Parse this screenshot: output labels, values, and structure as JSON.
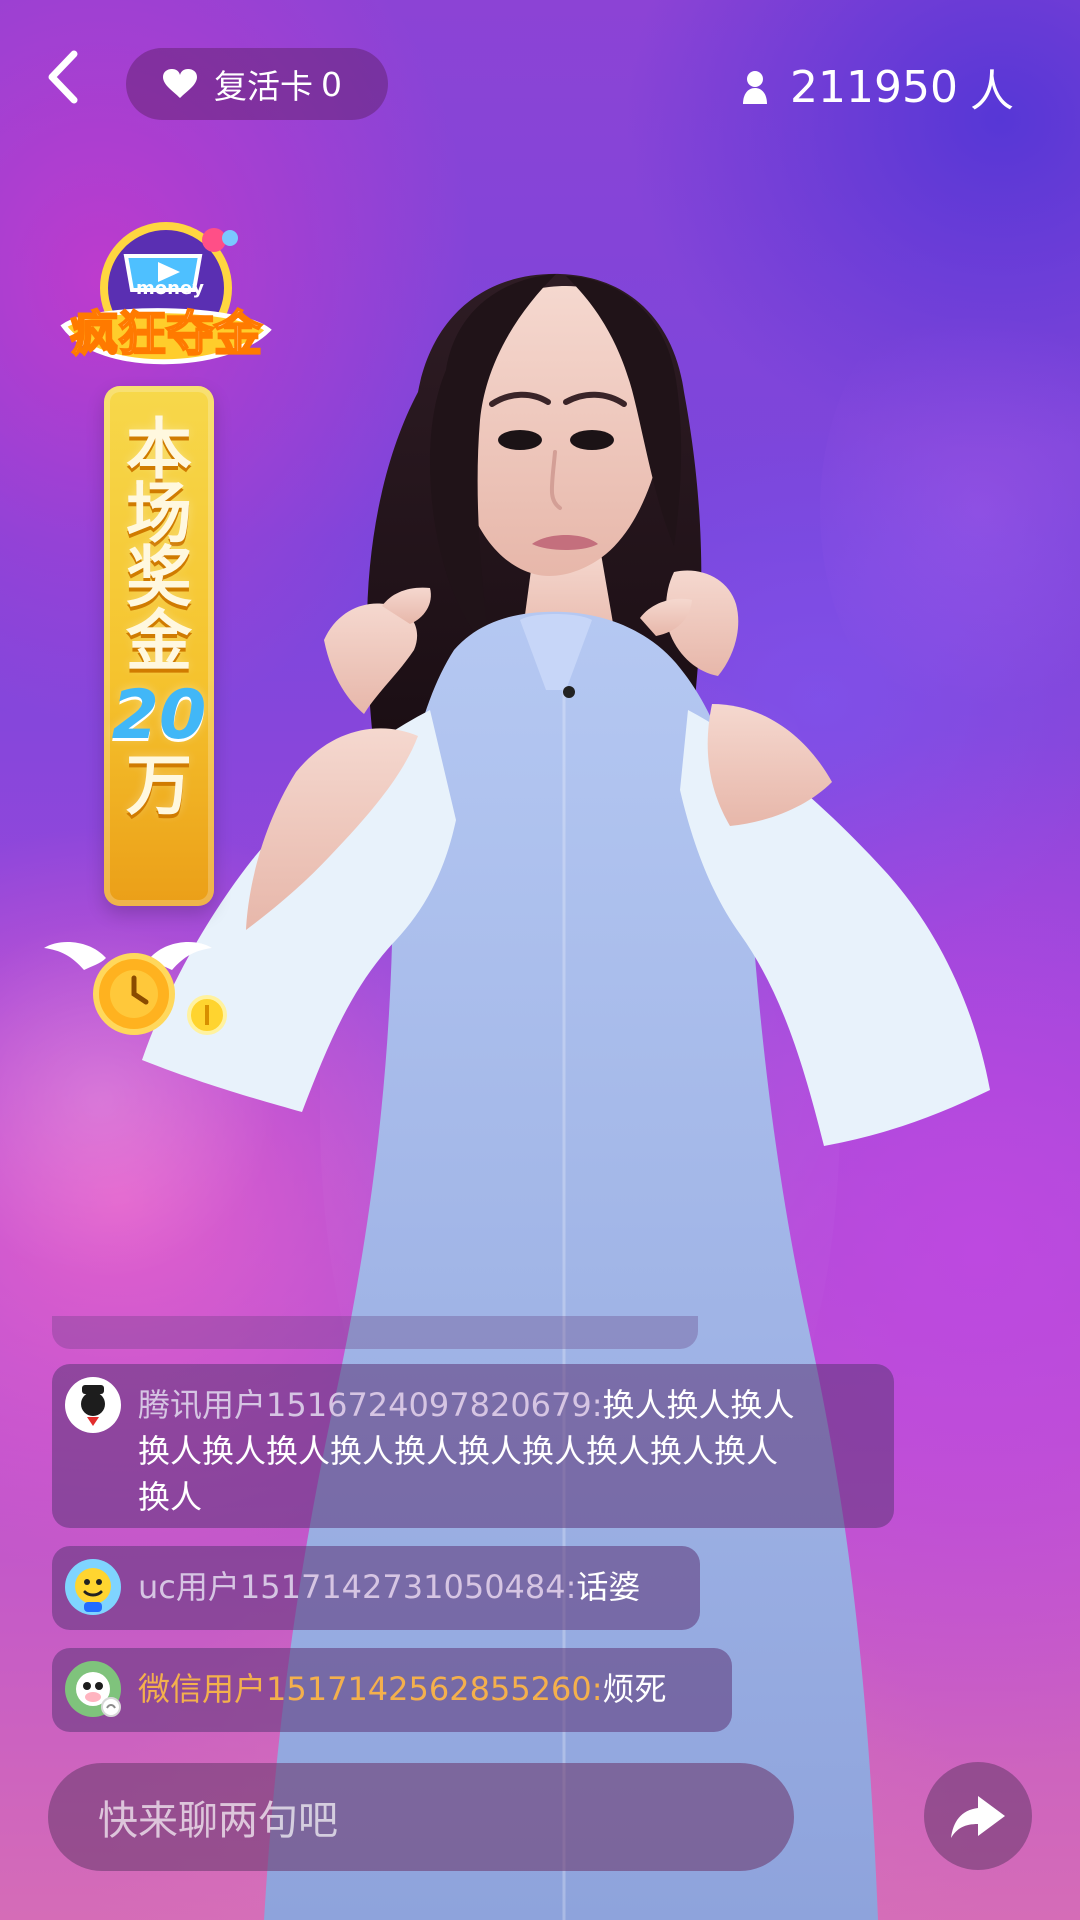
{
  "header": {
    "revive_label": "复活卡",
    "revive_count": "0",
    "viewer_count": "211950",
    "viewer_unit": "人"
  },
  "promo": {
    "title": "疯狂夺金",
    "title_tag": "money",
    "prize_chars": [
      "本",
      "场",
      "奖",
      "金"
    ],
    "prize_amount": "20",
    "prize_unit": "万"
  },
  "comments": [
    {
      "user": "腾讯用户1516724097820679",
      "separator": ":",
      "lines": [
        "换人换人换人",
        "换人换人换人换人换人换人换人换人换人换人",
        "换人"
      ],
      "avatar": "tencent-user-avatar",
      "highlight": false
    },
    {
      "user": "uc用户1517142731050484",
      "separator": ":",
      "message": "话婆",
      "avatar": "uc-user-avatar",
      "highlight": false
    },
    {
      "user": "微信用户1517142562855260",
      "separator": ":",
      "message": "烦死",
      "avatar": "wechat-user-avatar",
      "highlight": true
    }
  ],
  "chat": {
    "placeholder": "快来聊两句吧"
  },
  "icons": {
    "back": "back-arrow-icon",
    "revive": "heart-icon",
    "viewer": "person-icon",
    "share": "share-arrow-icon",
    "promo_clock": "clock-icon"
  },
  "colors": {
    "background_top": "#8c43d5",
    "background_bottom": "#d56cb7",
    "highlight_user": "#f4b04c",
    "comment_bubble": "#5f387a",
    "white": "#ffffff",
    "dress": "#a8bbe6"
  }
}
